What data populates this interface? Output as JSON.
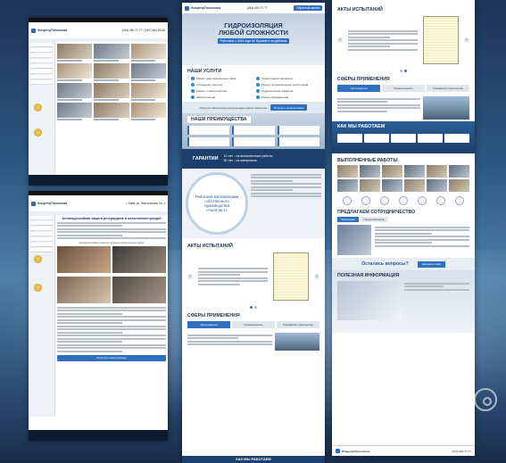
{
  "brand": "ИзоцентрТехнологии",
  "center": {
    "phone": "(044) 000-77-77",
    "address": "г. Киев, ул. Фактическая Ул. 1",
    "callback": "Обратный звонок",
    "hero_title_line1": "ГИДРОИЗОЛЯЦИЯ",
    "hero_title_line2": "ЛЮБОЙ СЛОЖНОСТИ",
    "hero_sub": "Работаем с 2004 года по Украине и за рубежом",
    "services_title": "НАШИ УСЛУГИ",
    "services": [
      "Ремонт деформационных швов",
      "Герметизация бассейнов",
      "Устранение протечек",
      "Ремонт железобетонных конструкций",
      "Ремонт и защита бетона",
      "Гидроизоляция подвалов",
      "Защита колонн",
      "Ремонт фундаментов"
    ],
    "cta_text": "Получите бесплатную консультацию наших экспертов",
    "cta_button": "Получить консультацию",
    "advantages_title": "НАШИ ПРЕИМУЩЕСТВА",
    "guarantee_title": "ГАРАНТИИ",
    "guarantee_1": "10 лет - на выполненные работы",
    "guarantee_2": "50 лет - на материалы",
    "own_materials": "Работаем материалами собственного производства «Акопласт»",
    "acts_title": "АКТЫ ИСПЫТАНИЙ",
    "spheres_title": "СФЕРЫ ПРИМЕНЕНИЯ",
    "spheres": [
      "Электромонтаж",
      "Промышленность",
      "Гражданское строительство"
    ],
    "bottom_title": "КАК МЫ РАБОТАЕМ"
  },
  "right": {
    "acts_title": "АКТЫ ИСПЫТАНИЙ",
    "spheres_title": "СФЕРЫ ПРИМЕНЕНИЯ",
    "spheres": [
      "Электромонтаж",
      "Промышленность",
      "Гражданское строительство"
    ],
    "how_title": "КАК МЫ РАБОТАЕМ",
    "works_title": "ВЫПОЛНЕННЫЕ РАБОТЫ",
    "coop_title": "ПРЕДЛАГАЕМ СОТРУДНИЧЕСТВО",
    "coop_tabs": [
      "Партнерам",
      "Представителям"
    ],
    "question": "Остались вопросы?",
    "question_btn": "Напишите нам!",
    "info_title": "ПОЛЕЗНАЯ ИНФОРМАЦИЯ",
    "footer_phone": "(044) 000-77-77"
  },
  "left_top": {
    "phone": "(044) 390-77-77 / (067) 463-99-45",
    "address": "г. Киев, ул. Фактическая Ул. 1"
  },
  "left_bottom": {
    "article_title": "Антикоррозийная защита резервуаров и металлоконструкций",
    "works_caption": "Антикоррозийная защита: примеры выполненных работ",
    "cta": "Получите консультацию"
  }
}
